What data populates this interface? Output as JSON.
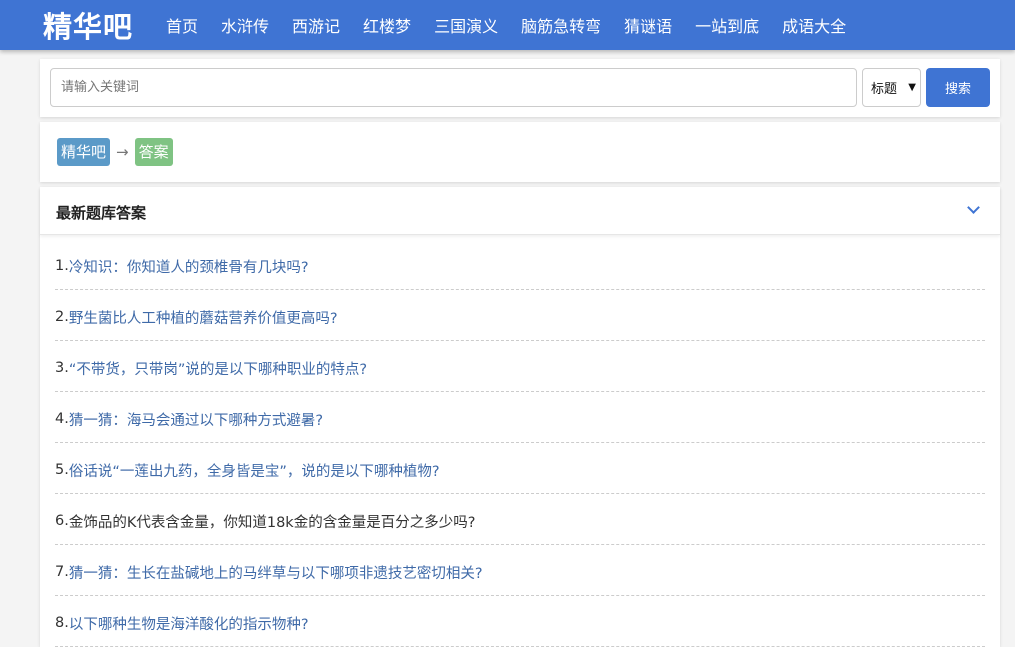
{
  "header": {
    "logo": "精华吧",
    "nav": [
      "首页",
      "水浒传",
      "西游记",
      "红楼梦",
      "三国演义",
      "脑筋急转弯",
      "猜谜语",
      "一站到底",
      "成语大全"
    ]
  },
  "search": {
    "placeholder": "请输入关键词",
    "select_value": "标题",
    "button_label": "搜索"
  },
  "breadcrumb": {
    "home": "精华吧",
    "arrow": "→",
    "current": "答案"
  },
  "list": {
    "title": "最新题库答案",
    "items": [
      {
        "num": "1.",
        "text": "冷知识：你知道人的颈椎骨有几块吗?"
      },
      {
        "num": "2.",
        "text": "野生菌比人工种植的蘑菇营养价值更高吗?"
      },
      {
        "num": "3.",
        "text": "“不带货，只带岗”说的是以下哪种职业的特点?"
      },
      {
        "num": "4.",
        "text": "猜一猜：海马会通过以下哪种方式避暑?"
      },
      {
        "num": "5.",
        "text": "俗话说“一莲出九药，全身皆是宝”，说的是以下哪种植物?"
      },
      {
        "num": "6.",
        "text": "金饰品的K代表含金量，你知道18k金的含金量是百分之多少吗?"
      },
      {
        "num": "7.",
        "text": "猜一猜：生长在盐碱地上的马绊草与以下哪项非遗技艺密切相关?"
      },
      {
        "num": "8.",
        "text": "以下哪种生物是海洋酸化的指示物种?"
      }
    ]
  },
  "colors": {
    "primary": "#3f74d3",
    "link": "#3f6aa8",
    "tag_blue": "#5b9ac8",
    "tag_green": "#7fc383"
  }
}
